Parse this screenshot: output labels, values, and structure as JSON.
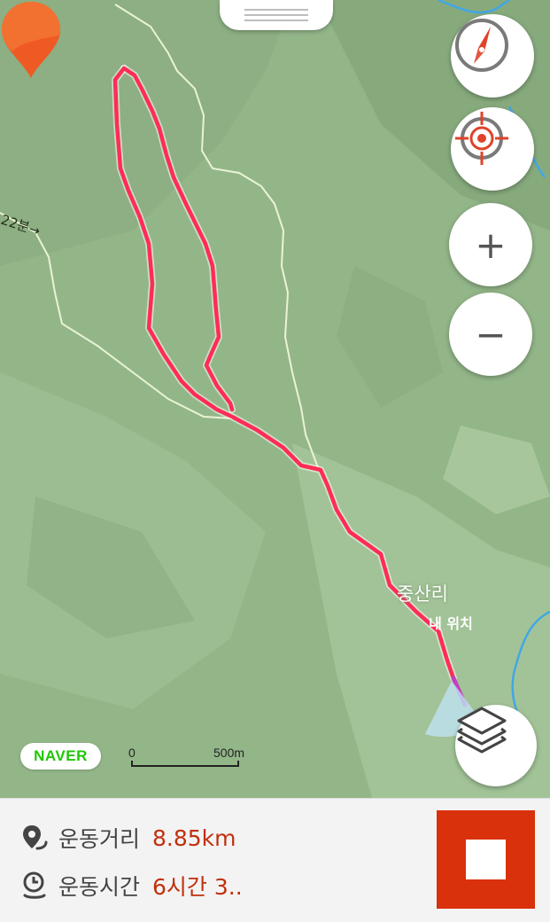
{
  "map": {
    "trail_label": "22분→",
    "place_name": "중산리",
    "my_location_label": "내 위치",
    "attribution": "NAVER",
    "scale": {
      "zero": "0",
      "distance": "500m"
    }
  },
  "controls": {
    "compass_icon": "compass-icon",
    "locate_icon": "crosshair-icon",
    "zoom_in_label": "+",
    "zoom_out_label": "−",
    "layers_icon": "layers-icon"
  },
  "workout": {
    "distance_label": "운동거리",
    "distance_value": "8.85km",
    "time_label": "운동시간",
    "time_value": "6시간 3..",
    "stop_icon": "stop-icon"
  },
  "colors": {
    "route": "#ff2d55",
    "accent": "#c0300e",
    "stop_button": "#d9310c"
  }
}
